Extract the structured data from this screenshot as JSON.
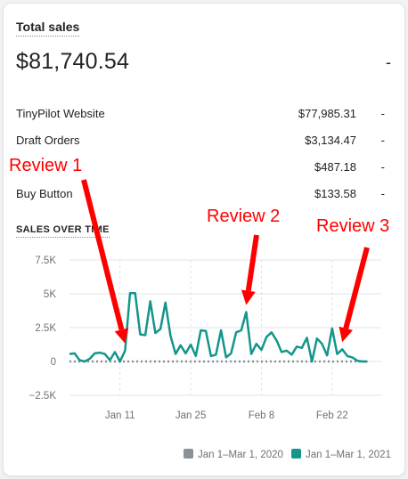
{
  "card": {
    "title": "Total sales",
    "total": "$81,740.54",
    "total_change": "-",
    "rows": [
      {
        "label": "TinyPilot Website",
        "value": "$77,985.31",
        "change": "-"
      },
      {
        "label": "Draft Orders",
        "value": "$3,134.47",
        "change": "-"
      },
      {
        "label": "",
        "value": "$487.18",
        "change": "-"
      },
      {
        "label": "Buy Button",
        "value": "$133.58",
        "change": "-"
      }
    ],
    "section_title": "SALES OVER TIME"
  },
  "chart_data": {
    "type": "line",
    "ylim": [
      -2500,
      7500
    ],
    "yticks": [
      7500,
      5000,
      2500,
      0,
      -2500
    ],
    "ytick_labels": [
      "7.5K",
      "5K",
      "2.5K",
      "0",
      "−2.5K"
    ],
    "x": [
      "Jan 1",
      "Jan 2",
      "Jan 3",
      "Jan 4",
      "Jan 5",
      "Jan 6",
      "Jan 7",
      "Jan 8",
      "Jan 9",
      "Jan 10",
      "Jan 11",
      "Jan 12",
      "Jan 13",
      "Jan 14",
      "Jan 15",
      "Jan 16",
      "Jan 17",
      "Jan 18",
      "Jan 19",
      "Jan 20",
      "Jan 21",
      "Jan 22",
      "Jan 23",
      "Jan 24",
      "Jan 25",
      "Jan 26",
      "Jan 27",
      "Jan 28",
      "Jan 29",
      "Jan 30",
      "Jan 31",
      "Feb 1",
      "Feb 2",
      "Feb 3",
      "Feb 4",
      "Feb 5",
      "Feb 6",
      "Feb 7",
      "Feb 8",
      "Feb 9",
      "Feb 10",
      "Feb 11",
      "Feb 12",
      "Feb 13",
      "Feb 14",
      "Feb 15",
      "Feb 16",
      "Feb 17",
      "Feb 18",
      "Feb 19",
      "Feb 20",
      "Feb 21",
      "Feb 22",
      "Feb 23",
      "Feb 24",
      "Feb 25",
      "Feb 26",
      "Feb 27",
      "Feb 28",
      "Mar 1"
    ],
    "xtick_labels": [
      {
        "label": "Jan 11",
        "at": "Jan 11"
      },
      {
        "label": "Jan 25",
        "at": "Jan 25"
      },
      {
        "label": "Feb 8",
        "at": "Feb 8"
      },
      {
        "label": "Feb 22",
        "at": "Feb 22"
      }
    ],
    "series": [
      {
        "name": "Jan 1–Mar 1, 2020",
        "color": "#8c9196",
        "style": "dotted",
        "values": [
          0,
          0,
          0,
          0,
          0,
          0,
          0,
          0,
          0,
          0,
          0,
          0,
          0,
          0,
          0,
          0,
          0,
          0,
          0,
          0,
          0,
          0,
          0,
          0,
          0,
          0,
          0,
          0,
          0,
          0,
          0,
          0,
          0,
          0,
          0,
          0,
          0,
          0,
          0,
          0,
          0,
          0,
          0,
          0,
          0,
          0,
          0,
          0,
          0,
          0,
          0,
          0,
          0,
          0,
          0,
          0,
          0,
          0,
          0,
          0
        ]
      },
      {
        "name": "Jan 1–Mar 1, 2021",
        "color": "#13968c",
        "style": "solid",
        "values": [
          550,
          600,
          100,
          0,
          200,
          600,
          650,
          550,
          100,
          700,
          0,
          800,
          5050,
          5050,
          2000,
          1950,
          4450,
          2100,
          2400,
          4350,
          1900,
          550,
          1200,
          600,
          1250,
          400,
          2300,
          2250,
          400,
          500,
          2300,
          300,
          600,
          2150,
          2300,
          3650,
          550,
          1300,
          850,
          1800,
          2150,
          1550,
          700,
          800,
          500,
          1100,
          1000,
          1750,
          0,
          1700,
          1300,
          450,
          2450,
          550,
          900,
          400,
          300,
          50,
          0,
          0
        ]
      }
    ],
    "legend_position": "bottom-right",
    "grid": true
  },
  "annotations": [
    {
      "text": "Review 1",
      "points_to": "Jan 12"
    },
    {
      "text": "Review 2",
      "points_to": "Feb 5"
    },
    {
      "text": "Review 3",
      "points_to": "Feb 24"
    }
  ],
  "colors": {
    "accent": "#13968c",
    "annotation": "#ff0000",
    "comparison": "#8c9196"
  }
}
